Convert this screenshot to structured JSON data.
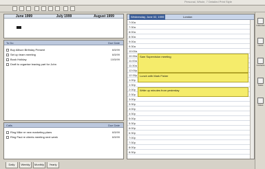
{
  "window": {
    "top_glint_text": "Personal, Whole, 7 Detailed Print Style"
  },
  "toolbar": {
    "buttons": [
      {
        "name": "new-item"
      },
      {
        "name": "open"
      },
      {
        "name": "save"
      },
      {
        "name": "print"
      },
      {
        "name": "cut"
      },
      {
        "name": "copy"
      },
      {
        "name": "paste"
      },
      {
        "name": "delete"
      },
      {
        "name": "find"
      }
    ]
  },
  "calendar": {
    "months": [
      {
        "label": "June 1999"
      },
      {
        "label": "July 1999"
      },
      {
        "label": "August 1999"
      }
    ],
    "today_index": 16
  },
  "todo": {
    "header": "To Do",
    "due_header": "Due Date",
    "items": [
      {
        "text": "Buy Allison Birthday Present",
        "due": "6/5/99"
      },
      {
        "text": "Set up team meeting",
        "due": "6/5/99"
      },
      {
        "text": "Book Holiday",
        "due": "10/5/99"
      },
      {
        "text": "Draft to organise leaving part for John",
        "due": ""
      }
    ]
  },
  "calls": {
    "header": "Calls",
    "due_header": "Due Date",
    "items": [
      {
        "text": "Ring Mike re new marketing plans",
        "due": "6/5/99"
      },
      {
        "text": "Ring Paul re clients meeting next week",
        "due": "6/5/99"
      }
    ]
  },
  "day": {
    "header_date": "Wednesday, June 02, 1999",
    "header_location": "London",
    "times": [
      "7:00a",
      "7:30a",
      "8:00a",
      "8:30a",
      "9:00a",
      "9:30a",
      "10:00a",
      "10:30a",
      "11:00a",
      "11:30a",
      "12:00p",
      "12:30p",
      "1:00p",
      "1:30p",
      "2:00p",
      "2:30p",
      "3:00p",
      "3:30p",
      "4:00p",
      "4:30p",
      "5:00p",
      "5:30p",
      "6:00p",
      "6:30p",
      "7:00p",
      "7:30p",
      "8:00p",
      "8:30p"
    ],
    "appointments": [
      {
        "text": "Sam Supervision meeting",
        "start": 7,
        "span": 4
      },
      {
        "text": "Lunch with Mark Fisher",
        "start": 11,
        "span": 2
      },
      {
        "text": "Write up minutes from yesterday",
        "start": 14,
        "span": 2
      }
    ]
  },
  "tabs": [
    {
      "label": "Daily"
    },
    {
      "label": "Weekly"
    },
    {
      "label": "Monthly"
    },
    {
      "label": "Yearly"
    }
  ],
  "sidebar": [
    {
      "label": "Calendar",
      "icon": "calendar-icon"
    },
    {
      "label": "Cards",
      "icon": "card-icon"
    },
    {
      "label": "Contacts",
      "icon": "contacts-icon"
    },
    {
      "label": "Tasks",
      "icon": "tasks-icon"
    },
    {
      "label": "Notes",
      "icon": "notes-icon"
    }
  ]
}
